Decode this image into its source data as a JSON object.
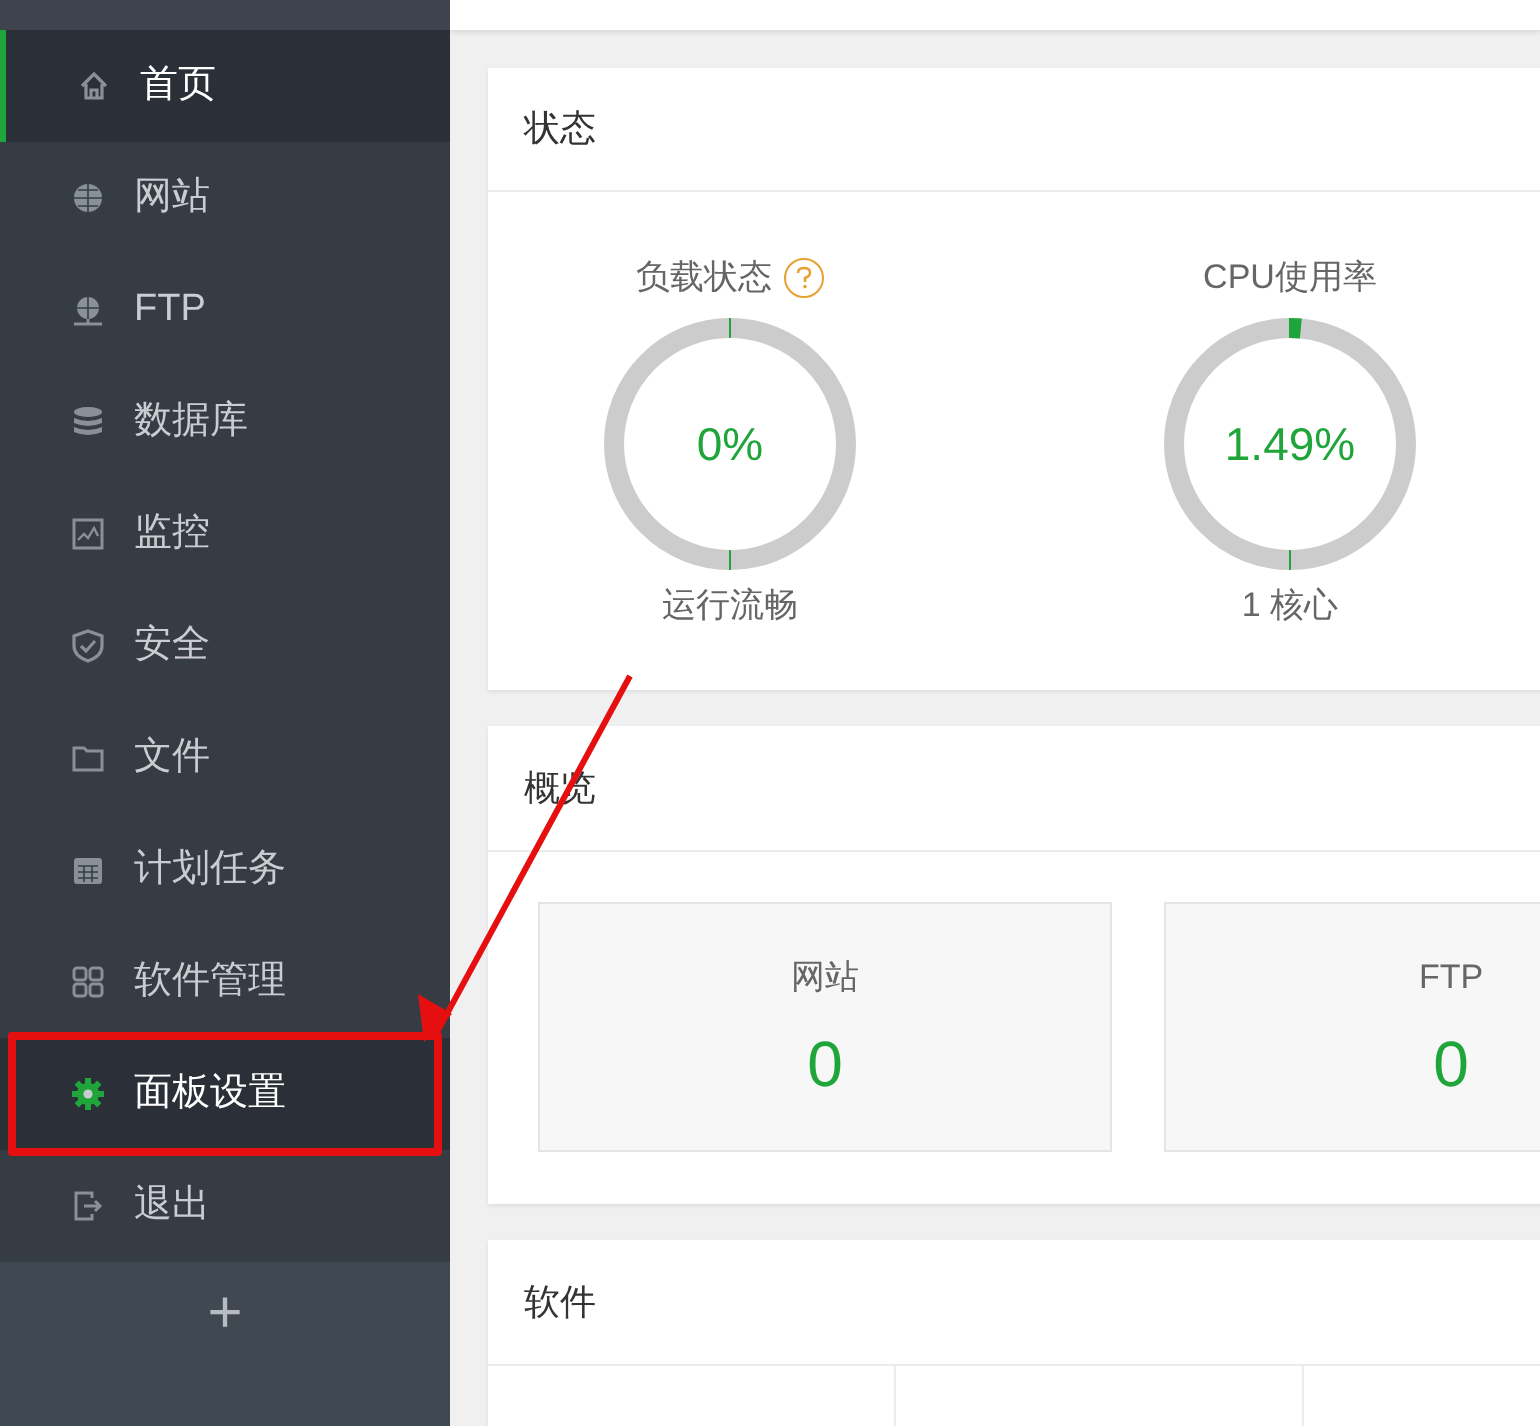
{
  "sidebar": {
    "items": [
      {
        "label": "首页",
        "selected": true,
        "highlighted": false,
        "annotated": false
      },
      {
        "label": "网站",
        "selected": false,
        "highlighted": false,
        "annotated": false
      },
      {
        "label": "FTP",
        "selected": false,
        "highlighted": false,
        "annotated": false
      },
      {
        "label": "数据库",
        "selected": false,
        "highlighted": false,
        "annotated": false
      },
      {
        "label": "监控",
        "selected": false,
        "highlighted": false,
        "annotated": false
      },
      {
        "label": "安全",
        "selected": false,
        "highlighted": false,
        "annotated": false
      },
      {
        "label": "文件",
        "selected": false,
        "highlighted": false,
        "annotated": false
      },
      {
        "label": "计划任务",
        "selected": false,
        "highlighted": false,
        "annotated": false
      },
      {
        "label": "软件管理",
        "selected": false,
        "highlighted": false,
        "annotated": false
      },
      {
        "label": "面板设置",
        "selected": false,
        "highlighted": true,
        "annotated": true
      },
      {
        "label": "退出",
        "selected": false,
        "highlighted": false,
        "annotated": false
      }
    ],
    "add_button": "+"
  },
  "status": {
    "title": "状态",
    "gauges": [
      {
        "label": "负载状态",
        "help": true,
        "value": "0%",
        "caption": "运行流畅"
      },
      {
        "label": "CPU使用率",
        "value": "1.49%",
        "caption": "1 核心"
      }
    ]
  },
  "overview": {
    "title": "概览",
    "tiles": [
      {
        "label": "网站",
        "value": "0"
      },
      {
        "label": "FTP",
        "value": "0"
      }
    ]
  },
  "software": {
    "title": "软件"
  }
}
